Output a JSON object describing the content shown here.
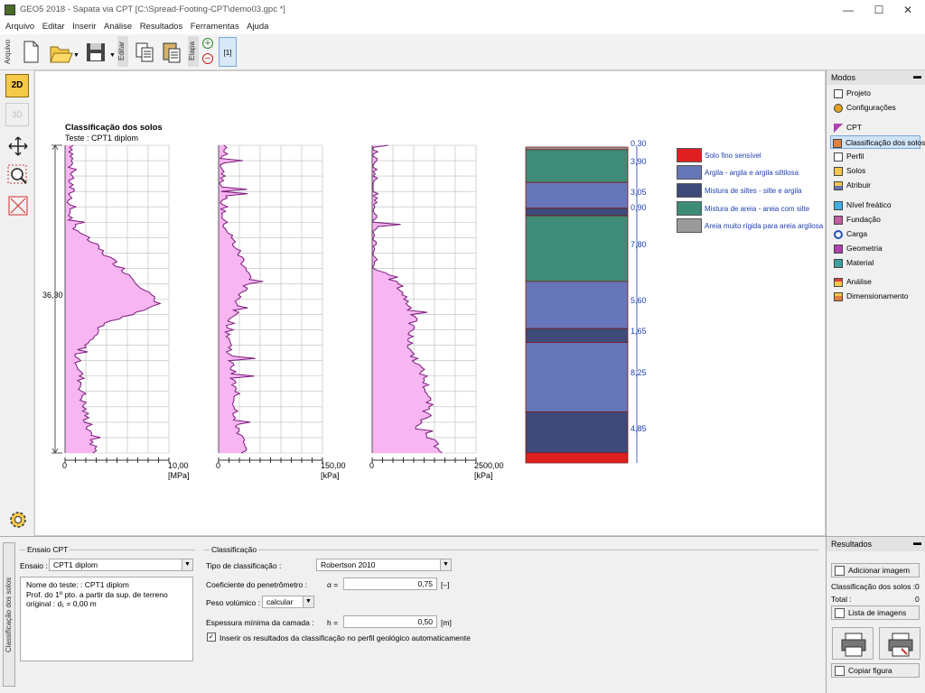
{
  "window": {
    "title": "GEO5 2018 - Sapata via CPT [C:\\Spread-Footing-CPT\\demo03.gpc *]",
    "minimize": "—",
    "maximize": "☐",
    "close": "✕"
  },
  "menu": [
    "Arquivo",
    "Editar",
    "Inserir",
    "Análise",
    "Resultados",
    "Ferramentas",
    "Ajuda"
  ],
  "toolbar": {
    "arquivo_label": "Arquivo",
    "editar_label": "Editar",
    "etapa_label": "Etapa",
    "stage": "[1]"
  },
  "left_tools": {
    "view2d": "2D",
    "view3d": "3D"
  },
  "chart": {
    "title": "Classificação dos solos",
    "subtitle": "Teste : CPT1 diplom",
    "depth_label": "36,30",
    "panels": [
      {
        "min": "0",
        "max": "10,00",
        "unit": "[MPa]"
      },
      {
        "min": "0",
        "max": "150,00",
        "unit": "[kPa]"
      },
      {
        "min": "0",
        "max": "2500,00",
        "unit": "[kPa]"
      }
    ],
    "column_thicknesses": [
      "0,30",
      "3,90",
      "3,05",
      "0,90",
      "7,80",
      "5,60",
      "1,65",
      "8,25",
      "4,85"
    ],
    "legend": [
      {
        "label": "Solo fino sensível",
        "color": "#e02020"
      },
      {
        "label": "Argila - argila e argila siltilosa",
        "color": "#6676b8"
      },
      {
        "label": "Mistura de siltes - silte e argila",
        "color": "#3d4a7a"
      },
      {
        "label": "Mistura de areia - areia com silte",
        "color": "#3e8c78"
      },
      {
        "label": "Areia muito rígida para areia argilosa",
        "color": "#9a9a9a"
      }
    ]
  },
  "right_panel": {
    "title": "Modos",
    "items": [
      "Projeto",
      "Configurações",
      "CPT",
      "Classificação dos solos",
      "Perfil",
      "Solos",
      "Atribuir",
      "Nível freático",
      "Fundação",
      "Carga",
      "Geometria",
      "Material",
      "Análise",
      "Dimensionamento"
    ]
  },
  "bottom": {
    "side_tab": "Classificação dos solos",
    "ensaio_group": "Ensaio CPT",
    "ensaio_label": "Ensaio :",
    "ensaio_value": "CPT1 diplom",
    "info_line1": "Nome do teste: : CPT1 diplom",
    "info_line2": "Prof. do 1º pto. a partir da sup. de terreno",
    "info_line3": "original : d₁ = 0,00 m",
    "class_group": "Classificação",
    "tipo_label": "Tipo de classificação :",
    "tipo_value": "Robertson 2010",
    "coef_label": "Coeficiente do penetrômetro :",
    "coef_sym": "α =",
    "coef_value": "0,75",
    "coef_unit": "[–]",
    "peso_label": "Peso volúmico :",
    "peso_value": "calcular",
    "esp_label": "Espessura mínima da camada :",
    "esp_sym": "h =",
    "esp_value": "0,50",
    "esp_unit": "[m]",
    "check_label": "Inserir os resultados da classificação no perfil geológico automaticamente"
  },
  "results": {
    "title": "Resultados",
    "add_image": "Adicionar imagem",
    "count_label": "Classificação dos solos :",
    "count_value": "0",
    "total_label": "Total :",
    "total_value": "0",
    "list_images": "Lista de imagens",
    "copy_figure": "Copiar figura"
  }
}
